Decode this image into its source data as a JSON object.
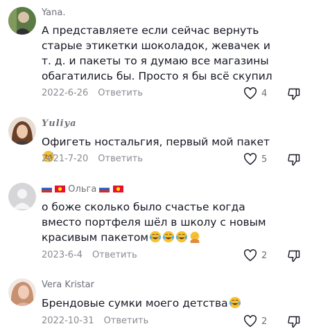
{
  "comments": [
    {
      "username": "Yana.",
      "text": "А представляете если сейчас вернуть старые этикетки шоколадок, жевачек и т. д. и пакеты то я думаю все магазины обагатились бы. Просто я бы всё скупил",
      "date": "2022-6-26",
      "reply_label": "Ответить",
      "likes": "4",
      "avatar_color": "#4a6a3a"
    },
    {
      "username": "𝒀𝒖𝒍𝒊𝒚𝒂",
      "text": "Офигеть ностальгия, первый мой пакет",
      "date": "2021-7-20",
      "reply_label": "Ответить",
      "likes": "5",
      "avatar_color": "#8a5a3c"
    },
    {
      "username": "Ольга",
      "text": "о боже сколько было счастье когда вместо портфеля шёл в школу с новым красивым пакетом",
      "date": "2023-6-4",
      "reply_label": "Ответить",
      "likes": "2",
      "avatar_color": "#d6d6d8"
    },
    {
      "username": "Vera Kristar",
      "text": "Брендовые сумки моего детства",
      "date": "2022-10-31",
      "reply_label": "Ответить",
      "likes": "2",
      "avatar_color": "#b07d6a"
    }
  ],
  "colors": {
    "text": "#161823",
    "secondary": "#8a8b91",
    "emoji": "#f7c232"
  }
}
